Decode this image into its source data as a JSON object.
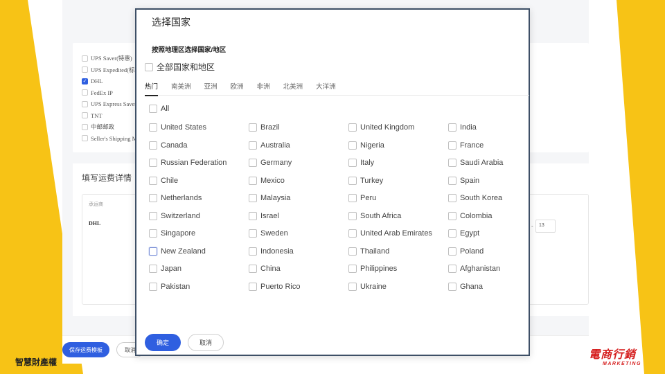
{
  "background": {
    "carriers": [
      {
        "label": "UPS Saver(特惠)",
        "checked": false
      },
      {
        "label": "UPS Expedited(标准)",
        "checked": false
      },
      {
        "label": "DHL",
        "checked": true
      },
      {
        "label": "FedEx IP",
        "checked": false
      },
      {
        "label": "UPS Express Saver",
        "checked": false
      },
      {
        "label": "TNT",
        "checked": false
      },
      {
        "label": "中邮邮政",
        "checked": false
      },
      {
        "label": "Seller's Shipping M",
        "checked": false
      }
    ],
    "section_title": "填写运费详情",
    "table": {
      "header_carrier": "承运商",
      "header_right": "",
      "row_carrier": "DHL",
      "dash": "-",
      "input_value": "13"
    },
    "save_button": "保存运费模板",
    "cancel_button": "取消"
  },
  "modal": {
    "title": "选择国家",
    "subtitle": "按照地理区选择国家/地区",
    "all_regions_label": "全部国家和地区",
    "tabs": [
      {
        "label": "热门",
        "active": true
      },
      {
        "label": "南美洲",
        "active": false
      },
      {
        "label": "亚洲",
        "active": false
      },
      {
        "label": "欧洲",
        "active": false
      },
      {
        "label": "非洲",
        "active": false
      },
      {
        "label": "北美洲",
        "active": false
      },
      {
        "label": "大洋洲",
        "active": false
      }
    ],
    "all_label": "All",
    "countries": [
      "United States",
      "Brazil",
      "United Kingdom",
      "India",
      "Canada",
      "Australia",
      "Nigeria",
      "France",
      "Russian Federation",
      "Germany",
      "Italy",
      "Saudi Arabia",
      "Chile",
      "Mexico",
      "Turkey",
      "Spain",
      "Netherlands",
      "Malaysia",
      "Peru",
      "South Korea",
      "Switzerland",
      "Israel",
      "South Africa",
      "Colombia",
      "Singapore",
      "Sweden",
      "United Arab Emirates",
      "Egypt",
      "New Zealand",
      "Indonesia",
      "Thailand",
      "Poland",
      "Japan",
      "China",
      "Philippines",
      "Afghanistan",
      "Pakistan",
      "Puerto Rico",
      "Ukraine",
      "Ghana"
    ],
    "focused_country": "New Zealand",
    "confirm_button": "确定",
    "cancel_button": "取消"
  },
  "captions": {
    "left": "智慧財產權",
    "faded": "",
    "brand_main": "電商行銷",
    "brand_sub": "MARKETING"
  },
  "colors": {
    "accent": "#2f5fe0",
    "slide_yellow": "#f7c316",
    "brand_red": "#d51d1d"
  }
}
